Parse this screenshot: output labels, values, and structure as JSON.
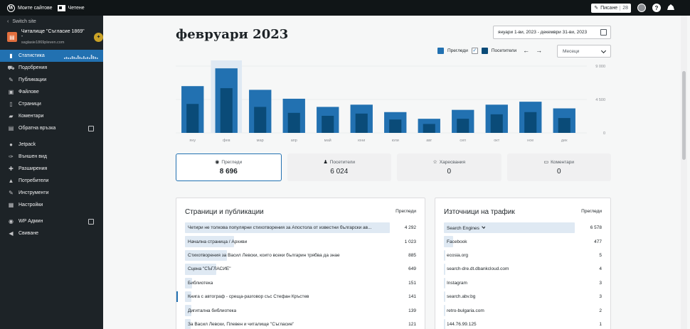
{
  "topbar": {
    "my_sites": "Моите сайтове",
    "reader": "Четене",
    "write": "Писане",
    "write_count": "28",
    "help": "?"
  },
  "sidebar": {
    "switch_site": "Switch site",
    "site_name": "Читалище \"Съгласие 1869\" -",
    "site_url": "saglasie1869pleven.com",
    "items": [
      {
        "label": "Статистика",
        "icon": "stats-icon",
        "active": true
      },
      {
        "label": "Подобрения",
        "icon": "cart-icon"
      },
      {
        "label": "Публикации",
        "icon": "pin-icon"
      },
      {
        "label": "Файлове",
        "icon": "media-icon"
      },
      {
        "label": "Страници",
        "icon": "page-icon"
      },
      {
        "label": "Коментари",
        "icon": "comment-icon"
      },
      {
        "label": "Обратна връзка",
        "icon": "feedback-icon",
        "external": true
      },
      {
        "label": "Jetpack",
        "icon": "jetpack-icon"
      },
      {
        "label": "Външен вид",
        "icon": "appearance-icon"
      },
      {
        "label": "Разширения",
        "icon": "plugins-icon"
      },
      {
        "label": "Потребители",
        "icon": "users-icon"
      },
      {
        "label": "Инструменти",
        "icon": "tools-icon"
      },
      {
        "label": "Настройки",
        "icon": "settings-icon"
      },
      {
        "label": "WP Админ",
        "icon": "wp-icon",
        "external": true
      },
      {
        "label": "Свиване",
        "icon": "collapse-icon"
      }
    ]
  },
  "main": {
    "title": "февруари 2023",
    "date_range": "януари 1-ви, 2023 - декември 31-ви, 2023",
    "legend": {
      "views": "Прегледи",
      "visitors": "Посетители"
    },
    "period": "Месеци"
  },
  "colors": {
    "views": "#2271b1",
    "visitors": "#0a4b78",
    "highlight": "#dfe9f3",
    "accent": "#2271b1"
  },
  "chart_data": {
    "type": "bar",
    "categories": [
      "яну",
      "фев",
      "мар",
      "апр",
      "май",
      "юни",
      "юли",
      "авг",
      "сеп",
      "окт",
      "ное",
      "дек"
    ],
    "series": [
      {
        "name": "Прегледи",
        "values": [
          6300,
          8696,
          5800,
          4600,
          3500,
          3800,
          2800,
          1900,
          3100,
          3800,
          4200,
          3300
        ]
      },
      {
        "name": "Посетители",
        "values": [
          3900,
          6024,
          3500,
          2700,
          2300,
          2600,
          1800,
          1200,
          1900,
          2500,
          2800,
          2000
        ]
      }
    ],
    "yticks": [
      "9 000",
      "4 500",
      "0"
    ],
    "ylim": [
      0,
      9000
    ],
    "highlight_index": 1
  },
  "cards": [
    {
      "label": "Прегледи",
      "value": "8 696",
      "icon": "eye-icon",
      "selected": true
    },
    {
      "label": "Посетители",
      "value": "6 024",
      "icon": "people-icon"
    },
    {
      "label": "Харесвания",
      "value": "0",
      "icon": "star-icon"
    },
    {
      "label": "Коментари",
      "value": "0",
      "icon": "comment-icon"
    }
  ],
  "posts_panel": {
    "title": "Страници и публикации",
    "column": "Прегледи",
    "rows": [
      {
        "label": "Четири не толкова популярни стихотворения за Апостола от известни български ав...",
        "value": "4 292",
        "n": 4292
      },
      {
        "label": "Начална страница / Архиви",
        "value": "1 023",
        "n": 1023
      },
      {
        "label": "Стихотворения за Васил Левски, които всеки българин трябва да знае",
        "value": "885",
        "n": 885
      },
      {
        "label": "Сцена \"СЪГЛАСИЕ\"",
        "value": "649",
        "n": 649
      },
      {
        "label": "Библиотека",
        "value": "151",
        "n": 151
      },
      {
        "label": "Книга с автограф - среща-разговор със Стефан Кръстев",
        "value": "141",
        "n": 141
      },
      {
        "label": "Дигитална библиотека",
        "value": "139",
        "n": 139
      },
      {
        "label": "За Васил Левски, Плевен и читалище \"Съгласие\"",
        "value": "121",
        "n": 121
      }
    ]
  },
  "referrers_panel": {
    "title": "Източници на трафик",
    "column": "Прегледи",
    "rows": [
      {
        "label": "Search Engines",
        "value": "6 578",
        "n": 6578
      },
      {
        "label": "Facebook",
        "value": "477",
        "n": 477
      },
      {
        "label": "ecosia.org",
        "value": "5",
        "n": 5
      },
      {
        "label": "search-dre.dt.dbankcloud.com",
        "value": "4",
        "n": 4
      },
      {
        "label": "Instagram",
        "value": "3",
        "n": 3
      },
      {
        "label": "search.abv.bg",
        "value": "3",
        "n": 3
      },
      {
        "label": "retro-bulgaria.com",
        "value": "2",
        "n": 2
      },
      {
        "label": "144.76.99.125",
        "value": "1",
        "n": 1
      }
    ]
  }
}
